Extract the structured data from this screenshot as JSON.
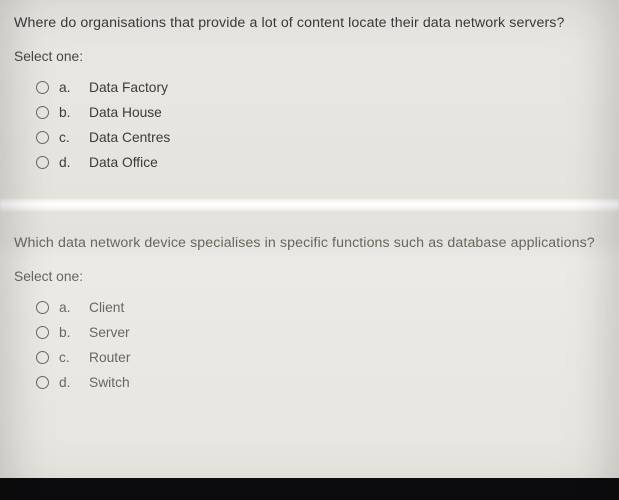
{
  "questions": [
    {
      "prompt": "Where do organisations that provide a lot of content locate their data network servers?",
      "select_label": "Select one:",
      "options": [
        {
          "letter": "a.",
          "label": "Data Factory"
        },
        {
          "letter": "b.",
          "label": "Data House"
        },
        {
          "letter": "c.",
          "label": "Data Centres"
        },
        {
          "letter": "d.",
          "label": "Data Office"
        }
      ]
    },
    {
      "prompt": "Which data network device specialises in specific functions such as database applications?",
      "select_label": "Select one:",
      "options": [
        {
          "letter": "a.",
          "label": "Client"
        },
        {
          "letter": "b.",
          "label": "Server"
        },
        {
          "letter": "c.",
          "label": "Router"
        },
        {
          "letter": "d.",
          "label": "Switch"
        }
      ]
    }
  ]
}
